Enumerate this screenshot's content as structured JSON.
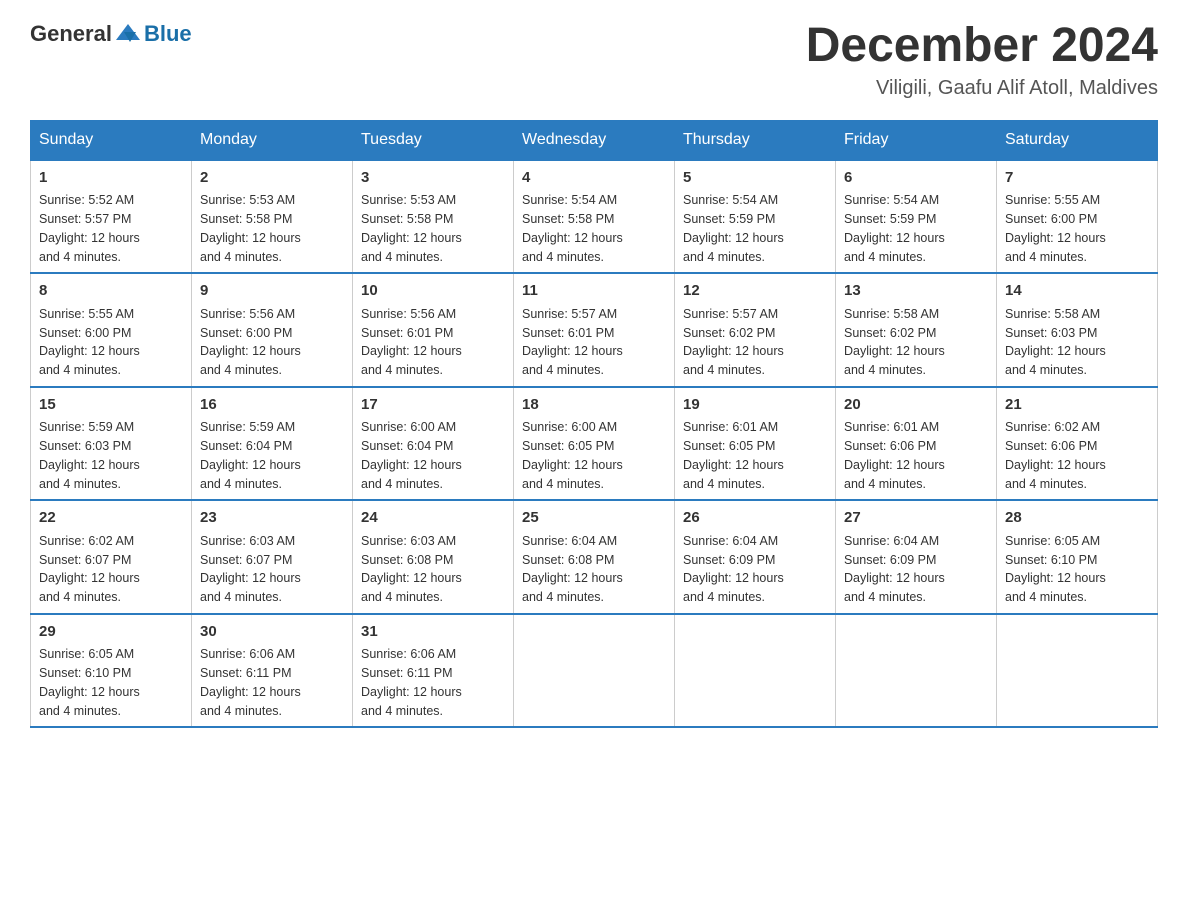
{
  "header": {
    "logo": {
      "text_general": "General",
      "text_blue": "Blue"
    },
    "title": "December 2024",
    "location": "Viligili, Gaafu Alif Atoll, Maldives"
  },
  "days_of_week": [
    "Sunday",
    "Monday",
    "Tuesday",
    "Wednesday",
    "Thursday",
    "Friday",
    "Saturday"
  ],
  "weeks": [
    [
      {
        "day": "1",
        "sunrise": "5:52 AM",
        "sunset": "5:57 PM",
        "daylight": "12 hours and 4 minutes."
      },
      {
        "day": "2",
        "sunrise": "5:53 AM",
        "sunset": "5:58 PM",
        "daylight": "12 hours and 4 minutes."
      },
      {
        "day": "3",
        "sunrise": "5:53 AM",
        "sunset": "5:58 PM",
        "daylight": "12 hours and 4 minutes."
      },
      {
        "day": "4",
        "sunrise": "5:54 AM",
        "sunset": "5:58 PM",
        "daylight": "12 hours and 4 minutes."
      },
      {
        "day": "5",
        "sunrise": "5:54 AM",
        "sunset": "5:59 PM",
        "daylight": "12 hours and 4 minutes."
      },
      {
        "day": "6",
        "sunrise": "5:54 AM",
        "sunset": "5:59 PM",
        "daylight": "12 hours and 4 minutes."
      },
      {
        "day": "7",
        "sunrise": "5:55 AM",
        "sunset": "6:00 PM",
        "daylight": "12 hours and 4 minutes."
      }
    ],
    [
      {
        "day": "8",
        "sunrise": "5:55 AM",
        "sunset": "6:00 PM",
        "daylight": "12 hours and 4 minutes."
      },
      {
        "day": "9",
        "sunrise": "5:56 AM",
        "sunset": "6:00 PM",
        "daylight": "12 hours and 4 minutes."
      },
      {
        "day": "10",
        "sunrise": "5:56 AM",
        "sunset": "6:01 PM",
        "daylight": "12 hours and 4 minutes."
      },
      {
        "day": "11",
        "sunrise": "5:57 AM",
        "sunset": "6:01 PM",
        "daylight": "12 hours and 4 minutes."
      },
      {
        "day": "12",
        "sunrise": "5:57 AM",
        "sunset": "6:02 PM",
        "daylight": "12 hours and 4 minutes."
      },
      {
        "day": "13",
        "sunrise": "5:58 AM",
        "sunset": "6:02 PM",
        "daylight": "12 hours and 4 minutes."
      },
      {
        "day": "14",
        "sunrise": "5:58 AM",
        "sunset": "6:03 PM",
        "daylight": "12 hours and 4 minutes."
      }
    ],
    [
      {
        "day": "15",
        "sunrise": "5:59 AM",
        "sunset": "6:03 PM",
        "daylight": "12 hours and 4 minutes."
      },
      {
        "day": "16",
        "sunrise": "5:59 AM",
        "sunset": "6:04 PM",
        "daylight": "12 hours and 4 minutes."
      },
      {
        "day": "17",
        "sunrise": "6:00 AM",
        "sunset": "6:04 PM",
        "daylight": "12 hours and 4 minutes."
      },
      {
        "day": "18",
        "sunrise": "6:00 AM",
        "sunset": "6:05 PM",
        "daylight": "12 hours and 4 minutes."
      },
      {
        "day": "19",
        "sunrise": "6:01 AM",
        "sunset": "6:05 PM",
        "daylight": "12 hours and 4 minutes."
      },
      {
        "day": "20",
        "sunrise": "6:01 AM",
        "sunset": "6:06 PM",
        "daylight": "12 hours and 4 minutes."
      },
      {
        "day": "21",
        "sunrise": "6:02 AM",
        "sunset": "6:06 PM",
        "daylight": "12 hours and 4 minutes."
      }
    ],
    [
      {
        "day": "22",
        "sunrise": "6:02 AM",
        "sunset": "6:07 PM",
        "daylight": "12 hours and 4 minutes."
      },
      {
        "day": "23",
        "sunrise": "6:03 AM",
        "sunset": "6:07 PM",
        "daylight": "12 hours and 4 minutes."
      },
      {
        "day": "24",
        "sunrise": "6:03 AM",
        "sunset": "6:08 PM",
        "daylight": "12 hours and 4 minutes."
      },
      {
        "day": "25",
        "sunrise": "6:04 AM",
        "sunset": "6:08 PM",
        "daylight": "12 hours and 4 minutes."
      },
      {
        "day": "26",
        "sunrise": "6:04 AM",
        "sunset": "6:09 PM",
        "daylight": "12 hours and 4 minutes."
      },
      {
        "day": "27",
        "sunrise": "6:04 AM",
        "sunset": "6:09 PM",
        "daylight": "12 hours and 4 minutes."
      },
      {
        "day": "28",
        "sunrise": "6:05 AM",
        "sunset": "6:10 PM",
        "daylight": "12 hours and 4 minutes."
      }
    ],
    [
      {
        "day": "29",
        "sunrise": "6:05 AM",
        "sunset": "6:10 PM",
        "daylight": "12 hours and 4 minutes."
      },
      {
        "day": "30",
        "sunrise": "6:06 AM",
        "sunset": "6:11 PM",
        "daylight": "12 hours and 4 minutes."
      },
      {
        "day": "31",
        "sunrise": "6:06 AM",
        "sunset": "6:11 PM",
        "daylight": "12 hours and 4 minutes."
      },
      null,
      null,
      null,
      null
    ]
  ],
  "labels": {
    "sunrise": "Sunrise:",
    "sunset": "Sunset:",
    "daylight": "Daylight:"
  }
}
